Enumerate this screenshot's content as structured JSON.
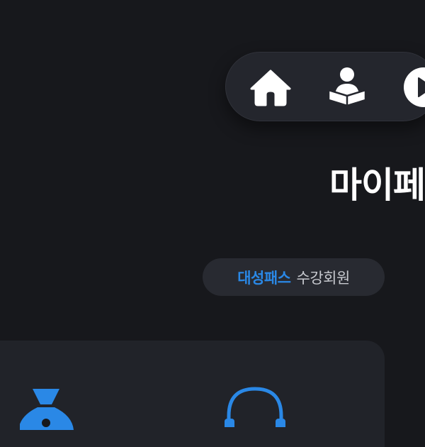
{
  "nav": {
    "items": [
      {
        "icon": "home-icon"
      },
      {
        "icon": "reader-icon"
      },
      {
        "icon": "play-icon"
      }
    ]
  },
  "page": {
    "title": "마이페"
  },
  "badge": {
    "brand": "대성패스",
    "rest": "수강회원"
  },
  "card": {
    "icons": [
      "money-bag-icon",
      "headset-icon"
    ]
  },
  "colors": {
    "background": "#17181c",
    "accent": "#2a88e6",
    "badge_text": "#c7c9cf",
    "nav_bg": "#24262d",
    "card_bg": "#212329"
  }
}
